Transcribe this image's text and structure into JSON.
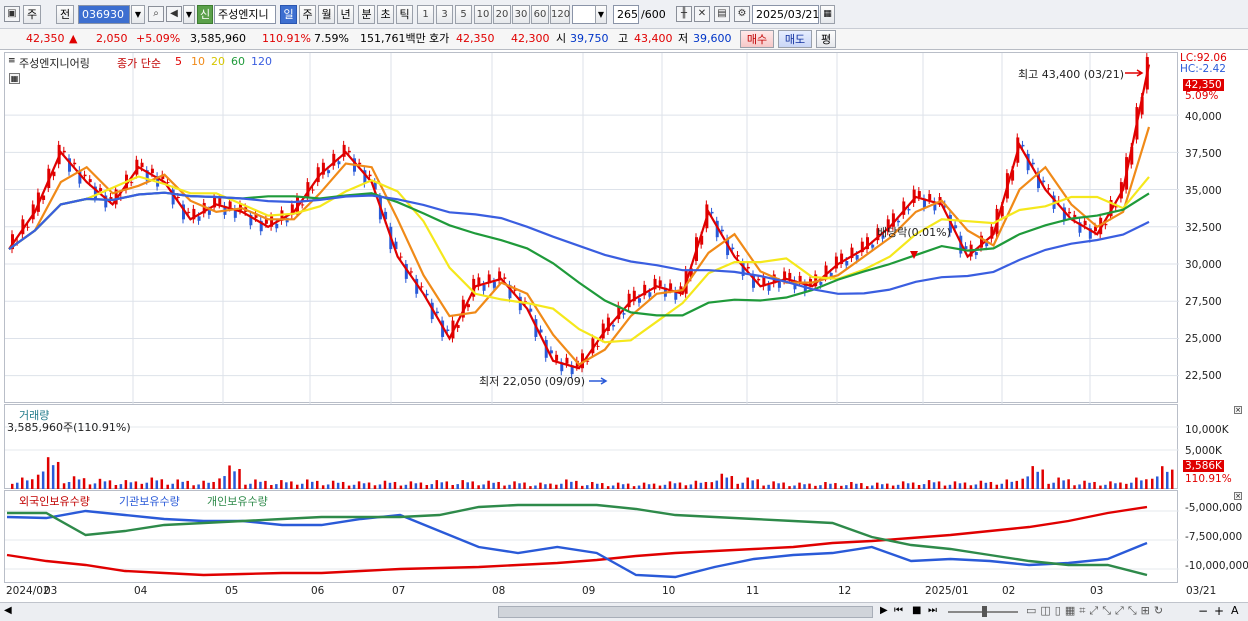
{
  "toolbar": {
    "mode": "주",
    "prefix": "전",
    "code": "036930",
    "badge": "신",
    "name": "주성엔지니",
    "periods": [
      "일",
      "주",
      "월",
      "년",
      "분",
      "초",
      "틱"
    ],
    "selected_period": "일",
    "intervals": [
      "1",
      "3",
      "5",
      "10",
      "20",
      "30",
      "60",
      "120"
    ],
    "count": "265",
    "count_total": "/600",
    "date": "2025/03/21"
  },
  "quote": {
    "price": "42,350",
    "arrow": "▲",
    "change": "2,050",
    "change_pct": "+5.09%",
    "volume": "3,585,960",
    "vol_ratio": "110.91%",
    "turnover": "7.59%",
    "amount": "151,761백만",
    "hoga_label": "호가",
    "hoga1": "42,350",
    "hoga2": "42,300",
    "open_label": "시",
    "open": "39,750",
    "high_label": "고",
    "high": "43,400",
    "low_label": "저",
    "low": "39,600",
    "buy": "매수",
    "sell": "매도",
    "eval": "평"
  },
  "price_pane": {
    "legend_name": "주성엔지니어링",
    "legend_ma": "종가 단순",
    "ma_periods": [
      "5",
      "10",
      "20",
      "60",
      "120"
    ],
    "ma_colors": [
      "#e00000",
      "#f08a18",
      "#f5e81c",
      "#1f9a3a",
      "#3a5ee0"
    ],
    "lc": "LC:92.06",
    "hc": "HC:-2.42",
    "last_price": "42,350",
    "last_pct": "5.09%",
    "ticks": [
      "40,000",
      "37,500",
      "35,000",
      "32,500",
      "30,000",
      "27,500",
      "25,000",
      "22,500"
    ],
    "high_note": "최고 43,400 (03/21)",
    "low_note": "최저 22,050 (09/09)",
    "dividend_note": "배당락(0.01%)"
  },
  "volume_pane": {
    "title": "거래량",
    "value": "3,585,960주(110.91%)",
    "ticks": [
      "10,000K",
      "5,000K"
    ],
    "last_tag": "3,586K",
    "last_pct": "110.91%"
  },
  "holdings_pane": {
    "series": [
      "외국인보유수량",
      "기관보유수량",
      "개인보유수량"
    ],
    "colors": [
      "#e00000",
      "#2a5ad8",
      "#2e8a4a"
    ],
    "ticks": [
      "-5,000,000",
      "-7,500,000",
      "-10,000,000"
    ]
  },
  "x_axis": {
    "labels": [
      "2024/02",
      "03",
      "04",
      "05",
      "06",
      "07",
      "08",
      "09",
      "10",
      "11",
      "12",
      "2025/01",
      "02",
      "03",
      "03/21"
    ]
  },
  "chart_data": {
    "type": "line",
    "title": "주성엔지니어링",
    "ylim": [
      21000,
      43500
    ],
    "ma_close": [
      31000,
      33500,
      37500,
      35500,
      34000,
      36500,
      35500,
      33000,
      34000,
      33500,
      32500,
      33500,
      36000,
      37500,
      35500,
      30500,
      28000,
      25000,
      28500,
      29000,
      27000,
      23500,
      23000,
      25500,
      27500,
      28500,
      28000,
      33500,
      30500,
      28500,
      29000,
      28500,
      30000,
      31000,
      32500,
      34500,
      34000,
      30500,
      32000,
      38000,
      35000,
      33000,
      32000,
      35000,
      43400
    ],
    "volume_k": [
      1800,
      5000,
      2000,
      1600,
      1400,
      1800,
      1500,
      1300,
      3700,
      1500,
      1400,
      1500,
      1300,
      1200,
      1300,
      1200,
      1400,
      1400,
      1300,
      1200,
      1000,
      1500,
      1100,
      1000,
      1000,
      1200,
      1300,
      2400,
      1800,
      1200,
      1000,
      1100,
      1100,
      1000,
      1200,
      1400,
      1200,
      1300,
      1500,
      3600,
      1800,
      1300,
      1200,
      1800,
      3586
    ]
  }
}
